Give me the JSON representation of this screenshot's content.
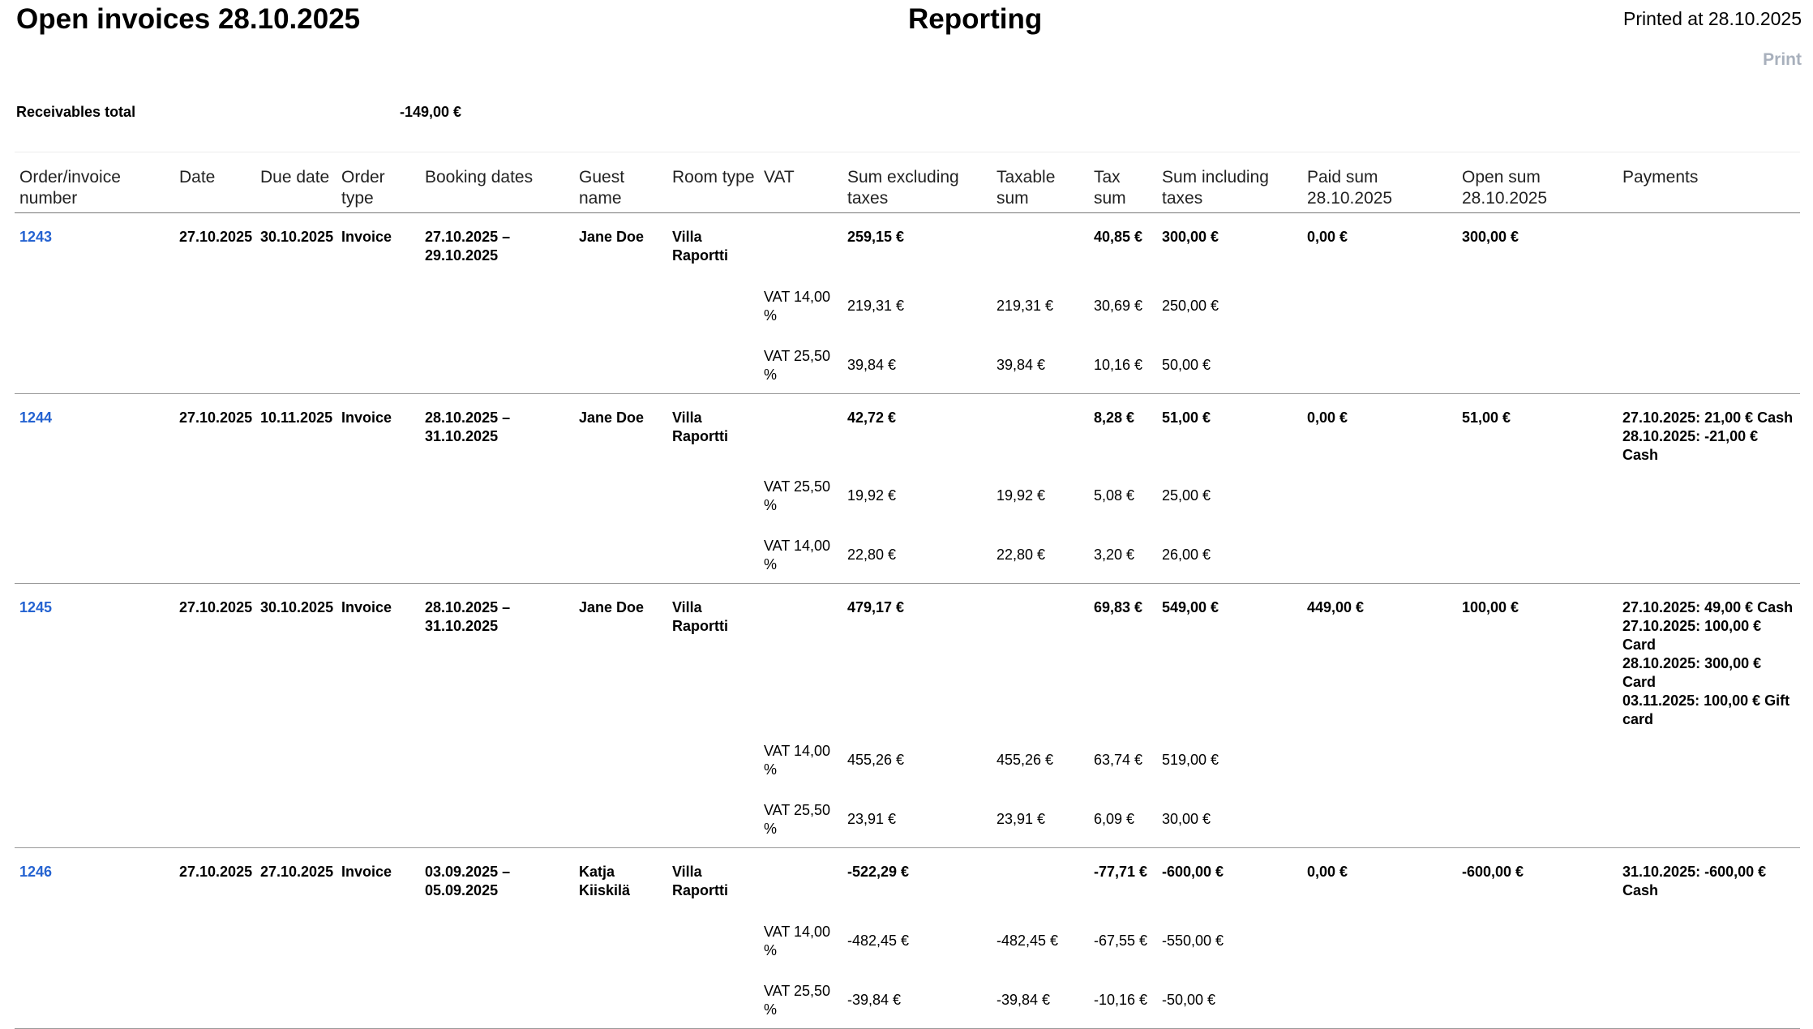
{
  "header": {
    "title": "Open invoices 28.10.2025",
    "center_title": "Reporting",
    "printed_at": "Printed at 28.10.2025",
    "print_label": "Print"
  },
  "receivables": {
    "label": "Receivables total",
    "value": "-149,00 €"
  },
  "columns": {
    "order": "Order/invoice number",
    "date": "Date",
    "due_date": "Due date",
    "order_type": "Order type",
    "booking_dates": "Booking dates",
    "guest_name": "Guest name",
    "room_type": "Room type",
    "vat": "VAT",
    "sum_excl": "Sum excluding taxes",
    "taxable": "Taxable sum",
    "tax": "Tax sum",
    "sum_incl": "Sum including taxes",
    "paid": "Paid sum 28.10.2025",
    "open": "Open sum 28.10.2025",
    "payments": "Payments"
  },
  "invoices": [
    {
      "number": "1243",
      "date": "27.10.2025",
      "due": "30.10.2025",
      "type": "Invoice",
      "booking": "27.10.2025 – 29.10.2025",
      "guest": "Jane Doe",
      "room": "Villa Raportti",
      "sum_excl": "259,15 €",
      "tax": "40,85 €",
      "sum_incl": "300,00 €",
      "paid": "0,00 €",
      "open": "300,00 €",
      "payments": [],
      "vat_rows": [
        {
          "vat": "VAT 14,00 %",
          "sum_excl": "219,31 €",
          "taxable": "219,31 €",
          "tax": "30,69 €",
          "sum_incl": "250,00 €"
        },
        {
          "vat": "VAT 25,50 %",
          "sum_excl": "39,84 €",
          "taxable": "39,84 €",
          "tax": "10,16 €",
          "sum_incl": "50,00 €"
        }
      ]
    },
    {
      "number": "1244",
      "date": "27.10.2025",
      "due": "10.11.2025",
      "type": "Invoice",
      "booking": "28.10.2025 – 31.10.2025",
      "guest": "Jane Doe",
      "room": "Villa Raportti",
      "sum_excl": "42,72 €",
      "tax": "8,28 €",
      "sum_incl": "51,00 €",
      "paid": "0,00 €",
      "open": "51,00 €",
      "payments": [
        "27.10.2025: 21,00 € Cash",
        "28.10.2025: -21,00 € Cash"
      ],
      "vat_rows": [
        {
          "vat": "VAT 25,50 %",
          "sum_excl": "19,92 €",
          "taxable": "19,92 €",
          "tax": "5,08 €",
          "sum_incl": "25,00 €"
        },
        {
          "vat": "VAT 14,00 %",
          "sum_excl": "22,80 €",
          "taxable": "22,80 €",
          "tax": "3,20 €",
          "sum_incl": "26,00 €"
        }
      ]
    },
    {
      "number": "1245",
      "date": "27.10.2025",
      "due": "30.10.2025",
      "type": "Invoice",
      "booking": "28.10.2025 – 31.10.2025",
      "guest": "Jane Doe",
      "room": "Villa Raportti",
      "sum_excl": "479,17 €",
      "tax": "69,83 €",
      "sum_incl": "549,00 €",
      "paid": "449,00 €",
      "open": "100,00 €",
      "payments": [
        "27.10.2025: 49,00 € Cash",
        "27.10.2025: 100,00 € Card",
        "28.10.2025: 300,00 € Card",
        "03.11.2025: 100,00 € Gift card"
      ],
      "vat_rows": [
        {
          "vat": "VAT 14,00 %",
          "sum_excl": "455,26 €",
          "taxable": "455,26 €",
          "tax": "63,74 €",
          "sum_incl": "519,00 €"
        },
        {
          "vat": "VAT 25,50 %",
          "sum_excl": "23,91 €",
          "taxable": "23,91 €",
          "tax": "6,09 €",
          "sum_incl": "30,00 €"
        }
      ]
    },
    {
      "number": "1246",
      "date": "27.10.2025",
      "due": "27.10.2025",
      "type": "Invoice",
      "booking": "03.09.2025 – 05.09.2025",
      "guest": "Katja Kiiskilä",
      "room": "Villa Raportti",
      "sum_excl": "-522,29 €",
      "tax": "-77,71 €",
      "sum_incl": "-600,00 €",
      "paid": "0,00 €",
      "open": "-600,00 €",
      "payments": [
        "31.10.2025: -600,00 € Cash"
      ],
      "vat_rows": [
        {
          "vat": "VAT 14,00 %",
          "sum_excl": "-482,45 €",
          "taxable": "-482,45 €",
          "tax": "-67,55 €",
          "sum_incl": "-550,00 €"
        },
        {
          "vat": "VAT 25,50 %",
          "sum_excl": "-39,84 €",
          "taxable": "-39,84 €",
          "tax": "-10,16 €",
          "sum_incl": "-50,00 €"
        }
      ]
    }
  ]
}
